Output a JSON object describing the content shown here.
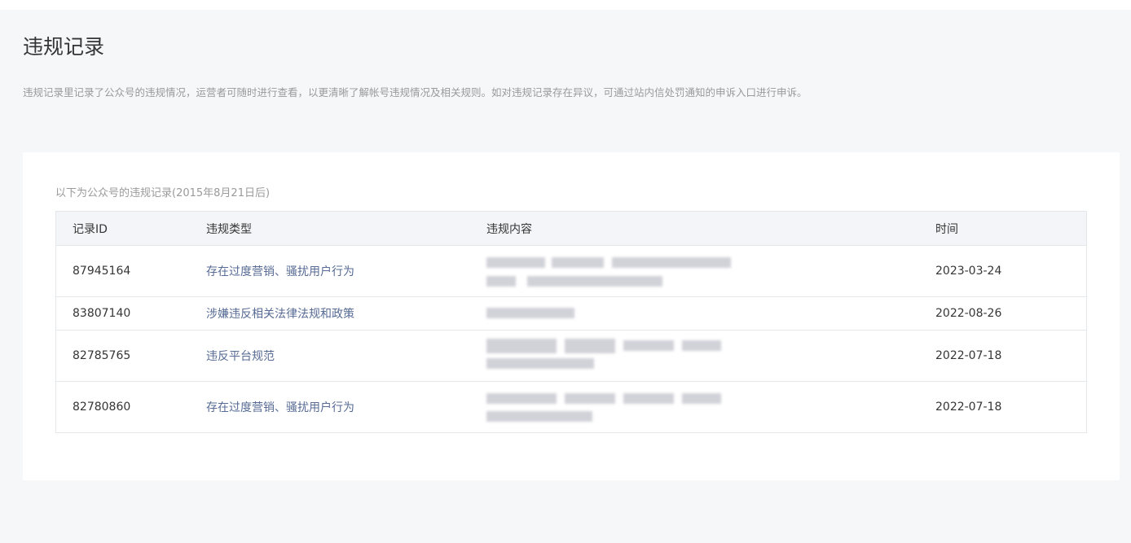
{
  "page": {
    "title": "违规记录",
    "description": "违规记录里记录了公众号的违规情况，运营者可随时进行查看，以更清晰了解帐号违规情况及相关规则。如对违规记录存在异议，可通过站内信处罚通知的申诉入口进行申诉。"
  },
  "table": {
    "caption": "以下为公众号的违规记录(2015年8月21日后)",
    "headers": {
      "id": "记录ID",
      "type": "违规类型",
      "content": "违规内容",
      "time": "时间"
    },
    "rows": [
      {
        "id": "87945164",
        "type": "存在过度营销、骚扰用户行为",
        "time": "2023-03-24"
      },
      {
        "id": "83807140",
        "type": "涉嫌违反相关法律法规和政策",
        "time": "2022-08-26"
      },
      {
        "id": "82785765",
        "type": "违反平台规范",
        "time": "2022-07-18"
      },
      {
        "id": "82780860",
        "type": "存在过度营销、骚扰用户行为",
        "time": "2022-07-18"
      }
    ]
  },
  "colors": {
    "page_bg": "#f6f7f9",
    "card_bg": "#ffffff",
    "link": "#576b95",
    "header_bg": "#f4f5f9",
    "muted_text": "#9a9a9a"
  }
}
